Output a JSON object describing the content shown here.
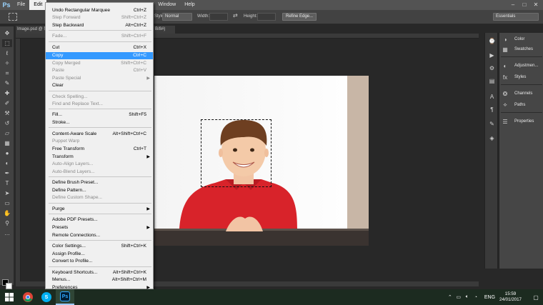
{
  "app": {
    "logo": "Ps"
  },
  "menubar": {
    "items": [
      "File",
      "Edit",
      "Window",
      "Help"
    ],
    "window_controls": [
      "–",
      "□",
      "✕"
    ]
  },
  "optionsbar": {
    "style_label": "Style:",
    "style_value": "Normal",
    "width_label": "Width:",
    "height_label": "Height:",
    "refine_edge": "Refine Edge...",
    "workspace": "Essentials"
  },
  "document": {
    "tab_label": "Image.psd @ 50% (Layer 1, RGB/8#)",
    "tab_tail": "B/8#)"
  },
  "edit_menu": {
    "items": [
      {
        "label": "Undo Rectangular Marquee",
        "shortcut": "Ctrl+Z",
        "disabled": false
      },
      {
        "label": "Step Forward",
        "shortcut": "Shift+Ctrl+Z",
        "disabled": true
      },
      {
        "label": "Step Backward",
        "shortcut": "Alt+Ctrl+Z",
        "disabled": false
      },
      {
        "label": "Fade...",
        "shortcut": "Shift+Ctrl+F",
        "disabled": true
      },
      {
        "label": "Cut",
        "shortcut": "Ctrl+X",
        "disabled": false
      },
      {
        "label": "Copy",
        "shortcut": "Ctrl+C",
        "disabled": false,
        "highlighted": true
      },
      {
        "label": "Copy Merged",
        "shortcut": "Shift+Ctrl+C",
        "disabled": true
      },
      {
        "label": "Paste",
        "shortcut": "Ctrl+V",
        "disabled": true
      },
      {
        "label": "Paste Special",
        "shortcut": "",
        "disabled": true,
        "submenu": true
      },
      {
        "label": "Clear",
        "shortcut": "",
        "disabled": false
      },
      {
        "label": "Check Spelling...",
        "shortcut": "",
        "disabled": true
      },
      {
        "label": "Find and Replace Text...",
        "shortcut": "",
        "disabled": true
      },
      {
        "label": "Fill...",
        "shortcut": "Shift+F5",
        "disabled": false
      },
      {
        "label": "Stroke...",
        "shortcut": "",
        "disabled": false
      },
      {
        "label": "Content-Aware Scale",
        "shortcut": "Alt+Shift+Ctrl+C",
        "disabled": false
      },
      {
        "label": "Puppet Warp",
        "shortcut": "",
        "disabled": true
      },
      {
        "label": "Free Transform",
        "shortcut": "Ctrl+T",
        "disabled": false
      },
      {
        "label": "Transform",
        "shortcut": "",
        "disabled": false,
        "submenu": true
      },
      {
        "label": "Auto-Align Layers...",
        "shortcut": "",
        "disabled": true
      },
      {
        "label": "Auto-Blend Layers...",
        "shortcut": "",
        "disabled": true
      },
      {
        "label": "Define Brush Preset...",
        "shortcut": "",
        "disabled": false
      },
      {
        "label": "Define Pattern...",
        "shortcut": "",
        "disabled": false
      },
      {
        "label": "Define Custom Shape...",
        "shortcut": "",
        "disabled": true
      },
      {
        "label": "Purge",
        "shortcut": "",
        "disabled": false,
        "submenu": true
      },
      {
        "label": "Adobe PDF Presets...",
        "shortcut": "",
        "disabled": false
      },
      {
        "label": "Presets",
        "shortcut": "",
        "disabled": false,
        "submenu": true
      },
      {
        "label": "Remote Connections...",
        "shortcut": "",
        "disabled": false
      },
      {
        "label": "Color Settings...",
        "shortcut": "Shift+Ctrl+K",
        "disabled": false
      },
      {
        "label": "Assign Profile...",
        "shortcut": "",
        "disabled": false
      },
      {
        "label": "Convert to Profile...",
        "shortcut": "",
        "disabled": false
      },
      {
        "label": "Keyboard Shortcuts...",
        "shortcut": "Alt+Shift+Ctrl+K",
        "disabled": false
      },
      {
        "label": "Menus...",
        "shortcut": "Alt+Shift+Ctrl+M",
        "disabled": false
      },
      {
        "label": "Preferences",
        "shortcut": "",
        "disabled": false,
        "submenu": true
      }
    ]
  },
  "panels": {
    "items": [
      "Color",
      "Swatches",
      "Adjustmen...",
      "Styles",
      "Channels",
      "Paths",
      "Properties"
    ]
  },
  "taskbar": {
    "language": "ENG",
    "time": "15:59",
    "date": "24/01/2017"
  },
  "colors": {
    "accent": "#3399ff",
    "shirt": "#d8232a",
    "background_ui": "#535353"
  }
}
